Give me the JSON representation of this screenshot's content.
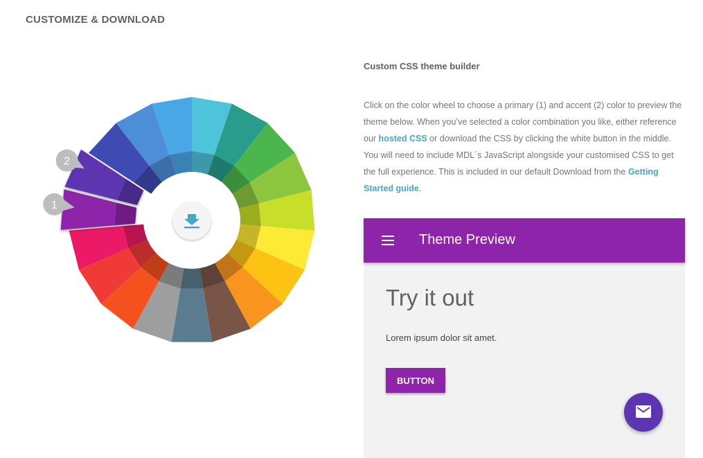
{
  "page": {
    "section_title": "CUSTOMIZE & DOWNLOAD"
  },
  "wheel": {
    "colors": [
      {
        "name": "cyan",
        "hex": "#4dc4da"
      },
      {
        "name": "teal",
        "hex": "#2a9c8c"
      },
      {
        "name": "green",
        "hex": "#4cb64e"
      },
      {
        "name": "light-green",
        "hex": "#8cc63f"
      },
      {
        "name": "lime",
        "hex": "#c8df2a"
      },
      {
        "name": "yellow",
        "hex": "#fcea34"
      },
      {
        "name": "amber",
        "hex": "#fcc314"
      },
      {
        "name": "orange",
        "hex": "#f9951f"
      },
      {
        "name": "brown",
        "hex": "#795548"
      },
      {
        "name": "blue-grey",
        "hex": "#5b7c8e"
      },
      {
        "name": "grey",
        "hex": "#9e9e9e"
      },
      {
        "name": "deep-orange",
        "hex": "#f4511e"
      },
      {
        "name": "red",
        "hex": "#f03a37"
      },
      {
        "name": "pink",
        "hex": "#ec1a66"
      },
      {
        "name": "purple",
        "hex": "#8e24aa"
      },
      {
        "name": "deep-purple",
        "hex": "#5e35b1"
      },
      {
        "name": "indigo",
        "hex": "#3f4ab3"
      },
      {
        "name": "blue",
        "hex": "#4d8ed9"
      },
      {
        "name": "light-blue",
        "hex": "#4aa7e6"
      }
    ],
    "primary_selection": "1",
    "accent_selection": "2",
    "download_icon": "download-icon"
  },
  "builder": {
    "title": "Custom CSS theme builder",
    "desc_part1": "Click on the color wheel to choose a primary (1) and accent (2) color to preview the theme below. When you’ve selected a color combination you like, either reference our ",
    "hosted_link": "hosted CSS",
    "desc_part2": " or download the CSS by clicking the white button in the middle. You will need to include MDL´s JavaScript alongside your customised CSS to get the full experience. This is included in our default Download from the ",
    "guide_link": "Getting Started guide",
    "desc_part3": "."
  },
  "preview": {
    "appbar_title": "Theme Preview",
    "menu_icon": "menu-icon",
    "heading": "Try it out",
    "body_text": "Lorem ipsum dolor sit amet.",
    "button_label": "BUTTON",
    "fab_icon": "mail-icon",
    "primary_color": "#8e24aa",
    "accent_color": "#5e35b1"
  }
}
